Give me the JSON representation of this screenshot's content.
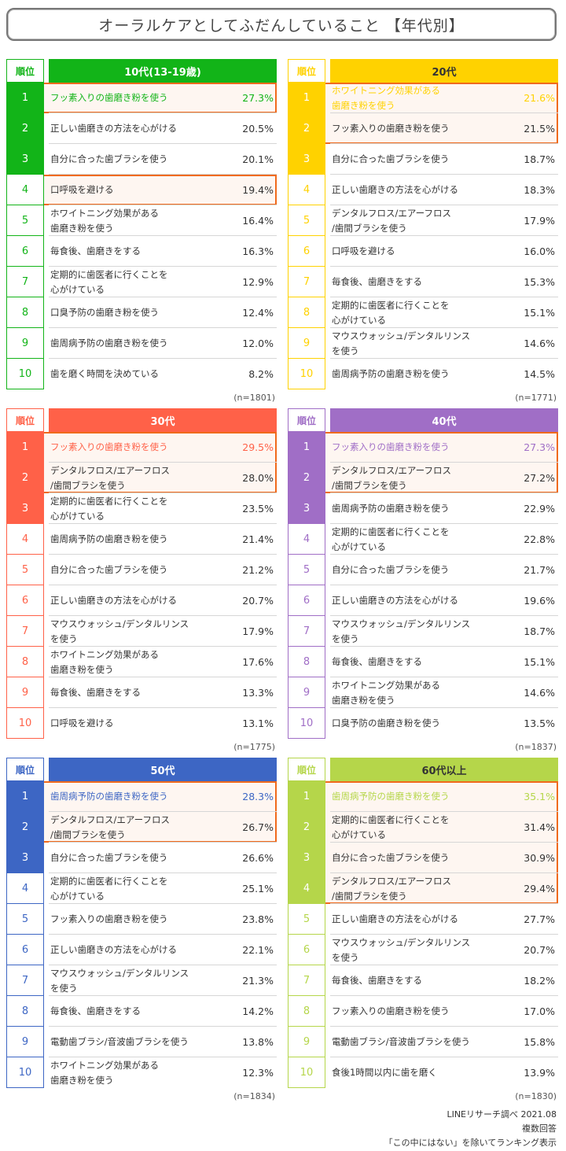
{
  "title": "オーラルケアとしてふだんしていること 【年代別】",
  "rank_header": "順位",
  "chart_data": [
    {
      "type": "table",
      "title": "10代(13-19歳)",
      "n": "(n=1801)",
      "color": "#12b418",
      "top_highlight": [
        1,
        4
      ],
      "items": [
        {
          "rank": "1",
          "label": "フッ素入りの歯磨き粉を使う",
          "value": "27.3%"
        },
        {
          "rank": "2",
          "label": "正しい歯磨きの方法を心がける",
          "value": "20.5%"
        },
        {
          "rank": "3",
          "label": "自分に合った歯ブラシを使う",
          "value": "20.1%"
        },
        {
          "rank": "4",
          "label": "口呼吸を避ける",
          "value": "19.4%"
        },
        {
          "rank": "5",
          "label": "ホワイトニング効果がある\n歯磨き粉を使う",
          "value": "16.4%"
        },
        {
          "rank": "6",
          "label": "毎食後、歯磨きをする",
          "value": "16.3%"
        },
        {
          "rank": "7",
          "label": "定期的に歯医者に行くことを\n心がけている",
          "value": "12.9%"
        },
        {
          "rank": "8",
          "label": "口臭予防の歯磨き粉を使う",
          "value": "12.4%"
        },
        {
          "rank": "9",
          "label": "歯周病予防の歯磨き粉を使う",
          "value": "12.0%"
        },
        {
          "rank": "10",
          "label": "歯を磨く時間を決めている",
          "value": "8.2%"
        }
      ]
    },
    {
      "type": "table",
      "title": "20代",
      "n": "(n=1771)",
      "color": "#ffd200",
      "top_highlight": [
        1,
        2
      ],
      "items": [
        {
          "rank": "1",
          "label": "ホワイトニング効果がある\n歯磨き粉を使う",
          "value": "21.6%"
        },
        {
          "rank": "2",
          "label": "フッ素入りの歯磨き粉を使う",
          "value": "21.5%"
        },
        {
          "rank": "3",
          "label": "自分に合った歯ブラシを使う",
          "value": "18.7%"
        },
        {
          "rank": "4",
          "label": "正しい歯磨きの方法を心がける",
          "value": "18.3%"
        },
        {
          "rank": "5",
          "label": "デンタルフロス/エアーフロス\n/歯間ブラシを使う",
          "value": "17.9%"
        },
        {
          "rank": "6",
          "label": "口呼吸を避ける",
          "value": "16.0%"
        },
        {
          "rank": "7",
          "label": "毎食後、歯磨きをする",
          "value": "15.3%"
        },
        {
          "rank": "8",
          "label": "定期的に歯医者に行くことを\n心がけている",
          "value": "15.1%"
        },
        {
          "rank": "9",
          "label": "マウスウォッシュ/デンタルリンス\nを使う",
          "value": "14.6%"
        },
        {
          "rank": "10",
          "label": "歯周病予防の歯磨き粉を使う",
          "value": "14.5%"
        }
      ]
    },
    {
      "type": "table",
      "title": "30代",
      "n": "(n=1775)",
      "color": "#ff6148",
      "top_highlight": [
        1,
        2
      ],
      "items": [
        {
          "rank": "1",
          "label": "フッ素入りの歯磨き粉を使う",
          "value": "29.5%"
        },
        {
          "rank": "2",
          "label": "デンタルフロス/エアーフロス\n/歯間ブラシを使う",
          "value": "28.0%"
        },
        {
          "rank": "3",
          "label": "定期的に歯医者に行くことを\n心がけている",
          "value": "23.5%"
        },
        {
          "rank": "4",
          "label": "歯周病予防の歯磨き粉を使う",
          "value": "21.4%"
        },
        {
          "rank": "5",
          "label": "自分に合った歯ブラシを使う",
          "value": "21.2%"
        },
        {
          "rank": "6",
          "label": "正しい歯磨きの方法を心がける",
          "value": "20.7%"
        },
        {
          "rank": "7",
          "label": "マウスウォッシュ/デンタルリンス\nを使う",
          "value": "17.9%"
        },
        {
          "rank": "8",
          "label": "ホワイトニング効果がある\n歯磨き粉を使う",
          "value": "17.6%"
        },
        {
          "rank": "9",
          "label": "毎食後、歯磨きをする",
          "value": "13.3%"
        },
        {
          "rank": "10",
          "label": "口呼吸を避ける",
          "value": "13.1%"
        }
      ]
    },
    {
      "type": "table",
      "title": "40代",
      "n": "(n=1837)",
      "color": "#a06ec6",
      "top_highlight": [
        1,
        2
      ],
      "items": [
        {
          "rank": "1",
          "label": "フッ素入りの歯磨き粉を使う",
          "value": "27.3%"
        },
        {
          "rank": "2",
          "label": "デンタルフロス/エアーフロス\n/歯間ブラシを使う",
          "value": "27.2%"
        },
        {
          "rank": "3",
          "label": "歯周病予防の歯磨き粉を使う",
          "value": "22.9%"
        },
        {
          "rank": "4",
          "label": "定期的に歯医者に行くことを\n心がけている",
          "value": "22.8%"
        },
        {
          "rank": "5",
          "label": "自分に合った歯ブラシを使う",
          "value": "21.7%"
        },
        {
          "rank": "6",
          "label": "正しい歯磨きの方法を心がける",
          "value": "19.6%"
        },
        {
          "rank": "7",
          "label": "マウスウォッシュ/デンタルリンス\nを使う",
          "value": "18.7%"
        },
        {
          "rank": "8",
          "label": "毎食後、歯磨きをする",
          "value": "15.1%"
        },
        {
          "rank": "9",
          "label": "ホワイトニング効果がある\n歯磨き粉を使う",
          "value": "14.6%"
        },
        {
          "rank": "10",
          "label": "口臭予防の歯磨き粉を使う",
          "value": "13.5%"
        }
      ]
    },
    {
      "type": "table",
      "title": "50代",
      "n": "(n=1834)",
      "color": "#3d66c4",
      "top_highlight": [
        1,
        2
      ],
      "items": [
        {
          "rank": "1",
          "label": "歯周病予防の歯磨き粉を使う",
          "value": "28.3%"
        },
        {
          "rank": "2",
          "label": "デンタルフロス/エアーフロス\n/歯間ブラシを使う",
          "value": "26.7%"
        },
        {
          "rank": "3",
          "label": "自分に合った歯ブラシを使う",
          "value": "26.6%"
        },
        {
          "rank": "4",
          "label": "定期的に歯医者に行くことを\n心がけている",
          "value": "25.1%"
        },
        {
          "rank": "5",
          "label": "フッ素入りの歯磨き粉を使う",
          "value": "23.8%"
        },
        {
          "rank": "6",
          "label": "正しい歯磨きの方法を心がける",
          "value": "22.1%"
        },
        {
          "rank": "7",
          "label": "マウスウォッシュ/デンタルリンス\nを使う",
          "value": "21.3%"
        },
        {
          "rank": "8",
          "label": "毎食後、歯磨きをする",
          "value": "14.2%"
        },
        {
          "rank": "9",
          "label": "電動歯ブラシ/音波歯ブラシを使う",
          "value": "13.8%"
        },
        {
          "rank": "10",
          "label": "ホワイトニング効果がある\n歯磨き粉を使う",
          "value": "12.3%"
        }
      ]
    },
    {
      "type": "table",
      "title": "60代以上",
      "n": "(n=1830)",
      "color": "#b5d64a",
      "top_highlight": [
        1,
        4
      ],
      "items": [
        {
          "rank": "1",
          "label": "歯周病予防の歯磨き粉を使う",
          "value": "35.1%"
        },
        {
          "rank": "2",
          "label": "定期的に歯医者に行くことを\n心がけている",
          "value": "31.4%"
        },
        {
          "rank": "3",
          "label": "自分に合った歯ブラシを使う",
          "value": "30.9%"
        },
        {
          "rank": "4",
          "label": "デンタルフロス/エアーフロス\n/歯間ブラシを使う",
          "value": "29.4%"
        },
        {
          "rank": "5",
          "label": "正しい歯磨きの方法を心がける",
          "value": "27.7%"
        },
        {
          "rank": "6",
          "label": "マウスウォッシュ/デンタルリンス\nを使う",
          "value": "20.7%"
        },
        {
          "rank": "7",
          "label": "毎食後、歯磨きをする",
          "value": "18.2%"
        },
        {
          "rank": "8",
          "label": "フッ素入りの歯磨き粉を使う",
          "value": "17.0%"
        },
        {
          "rank": "9",
          "label": "電動歯ブラシ/音波歯ブラシを使う",
          "value": "15.8%"
        },
        {
          "rank": "10",
          "label": "食後1時間以内に歯を磨く",
          "value": "13.9%"
        }
      ]
    }
  ],
  "footer": {
    "source": "LINEリサーチ調べ 2021.08",
    "note1": "複数回答",
    "note2": "「この中にはない」を除いてランキング表示"
  }
}
